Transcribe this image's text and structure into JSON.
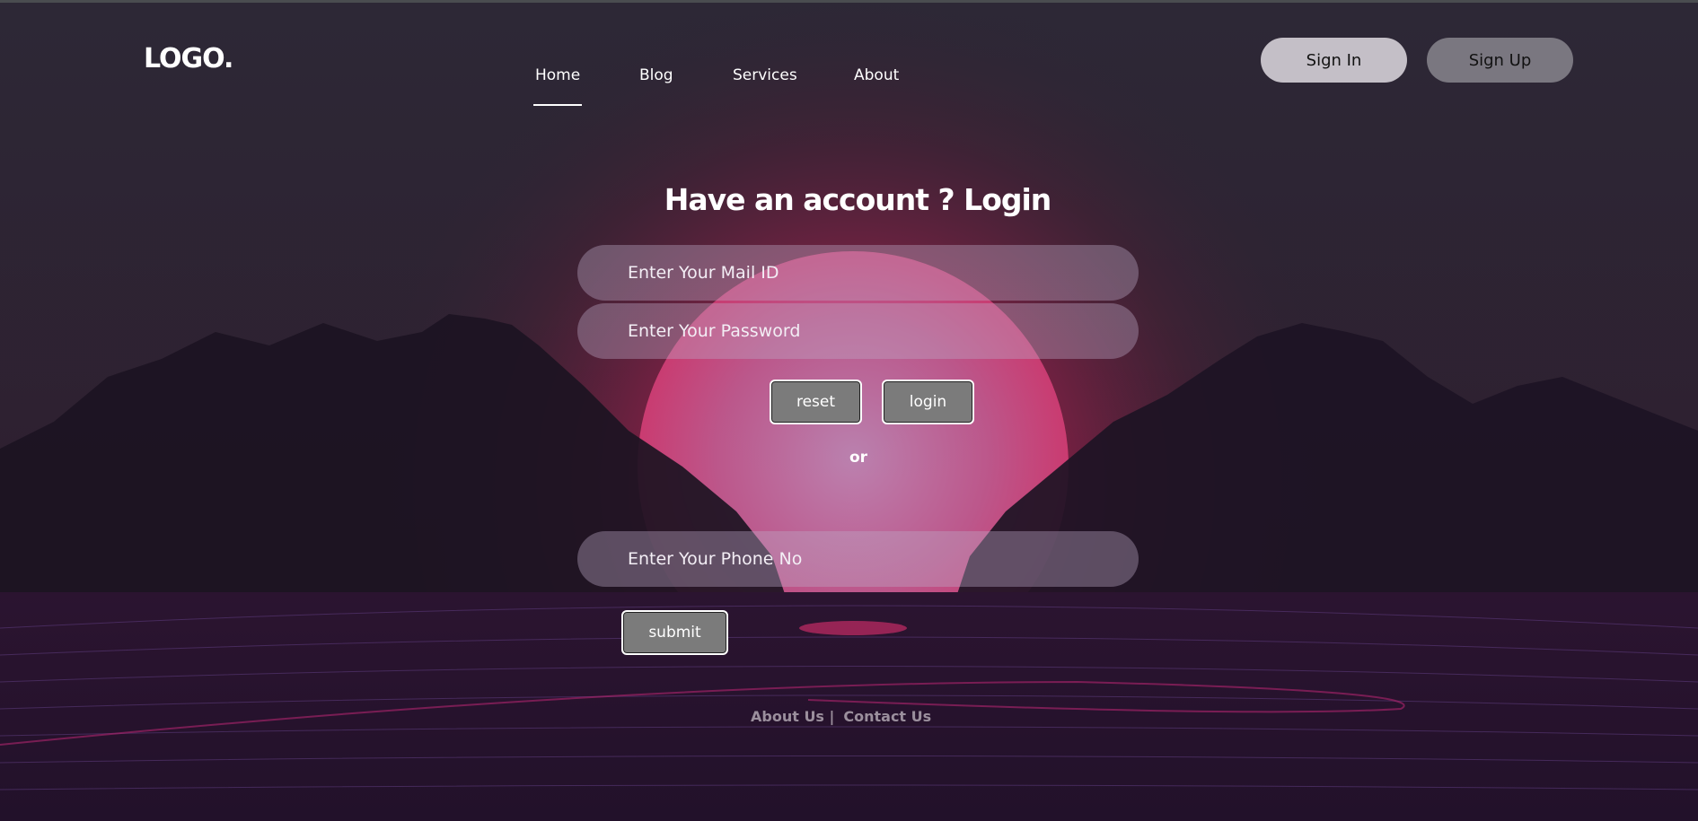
{
  "header": {
    "logo": "LOGO.",
    "nav": [
      "Home",
      "Blog",
      "Services",
      "About"
    ],
    "active_nav": "Home",
    "sign_in": "Sign In",
    "sign_up": "Sign Up"
  },
  "form": {
    "title": "Have an account ?  Login",
    "mail_placeholder": "Enter Your Mail ID",
    "password_placeholder": "Enter Your Password",
    "reset_label": "reset",
    "login_label": "login",
    "or_label": "or",
    "phone_placeholder": "Enter Your Phone No",
    "submit_label": "submit"
  },
  "footer": {
    "about": "About Us |",
    "contact": "Contact Us"
  },
  "colors": {
    "sun": "#e0336c",
    "bg_top": "#2b2635",
    "mountains": "#1b1221",
    "accent_lines": "#b01f6a"
  }
}
